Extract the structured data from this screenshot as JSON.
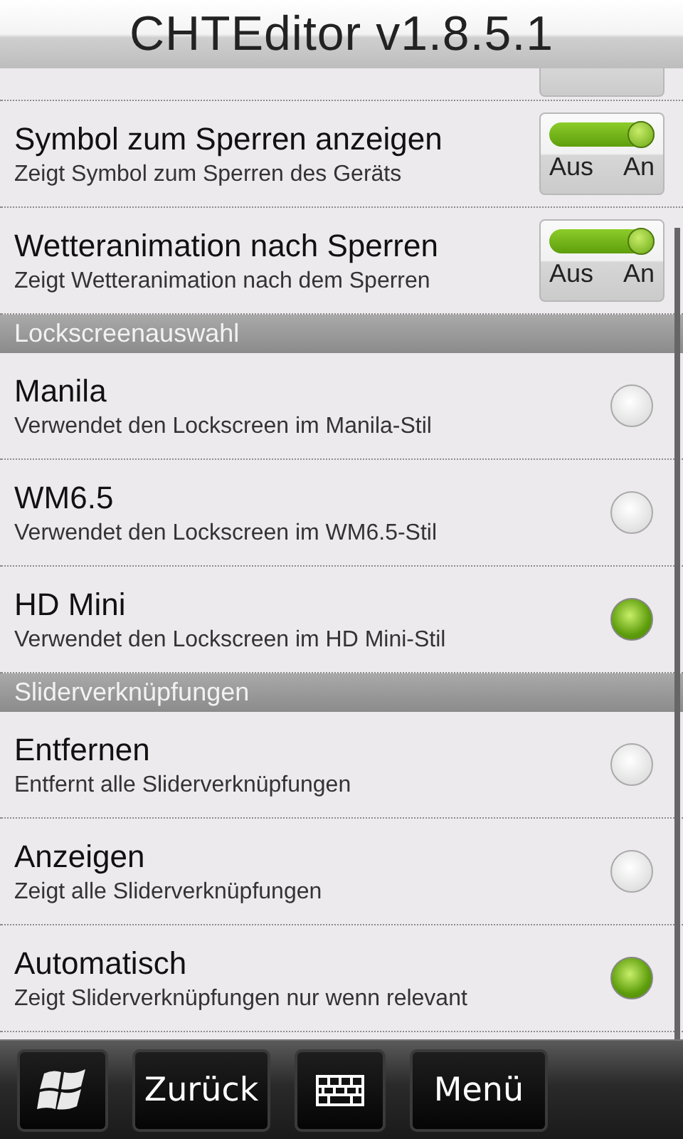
{
  "title": "CHTEditor v1.8.5.1",
  "sections": [
    {
      "items": [
        {
          "kind": "toggle_partial"
        },
        {
          "kind": "toggle",
          "title": "Symbol zum Sperren anzeigen",
          "subtitle": "Zeigt Symbol zum Sperren des Geräts",
          "on": true,
          "off_label": "Aus",
          "on_label": "An"
        },
        {
          "kind": "toggle",
          "title": "Wetteranimation nach Sperren",
          "subtitle": "Zeigt Wetteranimation nach dem Sperren",
          "on": true,
          "off_label": "Aus",
          "on_label": "An"
        }
      ]
    },
    {
      "header": "Lockscreenauswahl",
      "items": [
        {
          "kind": "radio",
          "title": "Manila",
          "subtitle": "Verwendet den Lockscreen im Manila-Stil",
          "selected": false
        },
        {
          "kind": "radio",
          "title": "WM6.5",
          "subtitle": "Verwendet den Lockscreen im WM6.5-Stil",
          "selected": false
        },
        {
          "kind": "radio",
          "title": "HD Mini",
          "subtitle": "Verwendet den Lockscreen im HD Mini-Stil",
          "selected": true
        }
      ]
    },
    {
      "header": "Sliderverknüpfungen",
      "items": [
        {
          "kind": "radio",
          "title": "Entfernen",
          "subtitle": "Entfernt alle Sliderverknüpfungen",
          "selected": false
        },
        {
          "kind": "radio",
          "title": "Anzeigen",
          "subtitle": "Zeigt alle Sliderverknüpfungen",
          "selected": false
        },
        {
          "kind": "radio",
          "title": "Automatisch",
          "subtitle": "Zeigt Sliderverknüpfungen nur wenn relevant",
          "selected": true
        }
      ]
    }
  ],
  "bottom_bar": [
    {
      "kind": "windows"
    },
    {
      "kind": "text",
      "label": "Zurück"
    },
    {
      "kind": "keyboard"
    },
    {
      "kind": "text",
      "label": "Menü"
    }
  ]
}
